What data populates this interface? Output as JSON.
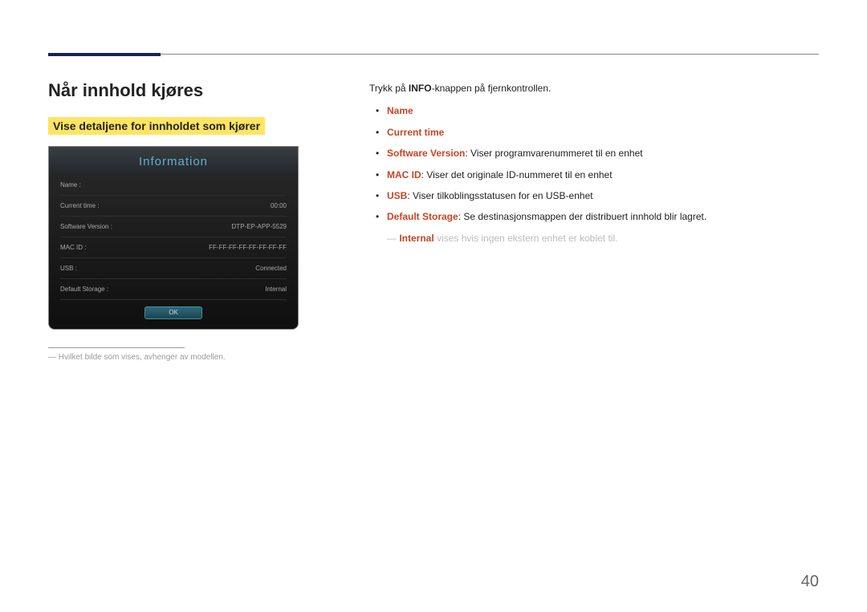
{
  "heading": "Når innhold kjøres",
  "subheader": "Vise detaljene for innholdet som kjører",
  "panel": {
    "title": "Information",
    "rows": [
      {
        "label": "Name :",
        "value": ""
      },
      {
        "label": "Current time :",
        "value": "00:00"
      },
      {
        "label": "Software Version :",
        "value": "DTP-EP-APP-5529"
      },
      {
        "label": "MAC ID :",
        "value": "FF-FF-FF-FF-FF-FF-FF-FF"
      },
      {
        "label": "USB :",
        "value": "Connected"
      },
      {
        "label": "Default Storage :",
        "value": "Internal"
      }
    ],
    "ok": "OK"
  },
  "panel_note": "Hvilket bilde som vises, avhenger av modellen.",
  "intro_pre": "Trykk på ",
  "intro_bold": "INFO",
  "intro_post": "-knappen på fjernkontrollen.",
  "bullets": {
    "name": "Name",
    "current_time": "Current time",
    "software_version_label": "Software Version",
    "software_version_text": ": Viser programvarenummeret til en enhet",
    "mac_id_label": "MAC ID",
    "mac_id_text": ": Viser det originale ID-nummeret til en enhet",
    "usb_label": "USB",
    "usb_text": ": Viser tilkoblingsstatusen for en USB-enhet",
    "default_storage_label": "Default Storage",
    "default_storage_text": ": Se destinasjonsmappen der distribuert innhold blir lagret."
  },
  "subnote_hl": "Internal",
  "subnote_rest": " vises hvis ingen ekstern enhet er koblet til.",
  "page_number": "40"
}
